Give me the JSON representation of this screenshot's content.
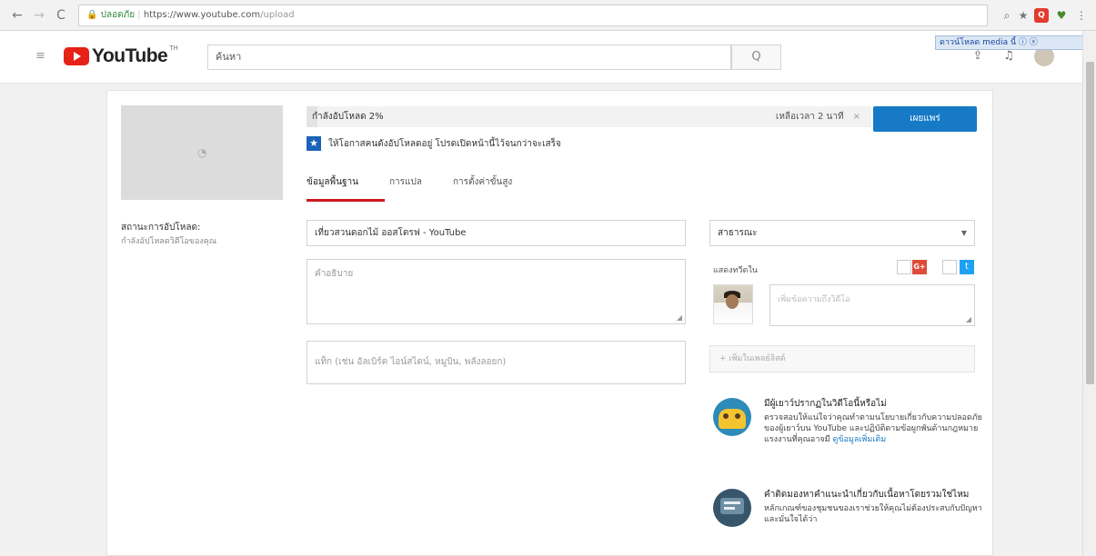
{
  "browser": {
    "back": "←",
    "forward": "→",
    "reload": "C",
    "secure_label": "ปลอดภัย",
    "url_host": "https://www.youtube.com",
    "url_path": "/upload",
    "zoom_icon": "magnifier-icon",
    "star_icon": "★"
  },
  "header": {
    "logo_text": "YouTube",
    "logo_sup": "TH",
    "search_placeholder": "ค้นหา",
    "search_icon": "Q",
    "notice": "ดาวน์โหลด media นี้ ⓘ ⓧ"
  },
  "upload": {
    "status_title": "สถานะการอัปโหลด:",
    "status_sub": "กำลังอัปโหลดวิดีโอของคุณ",
    "progress_label": "กำลังอัปโหลด 2%",
    "progress_percent": 2,
    "remaining": "เหลือเวลา 2 นาที",
    "cancel": "×",
    "publish_label": "เผยแพร่",
    "info_text": "ให้โอกาสคนดังอัปโหลดอยู่ โปรดเปิดหน้านี้ไว้จนกว่าจะเสร็จ"
  },
  "tabs": [
    {
      "label": "ข้อมูลพื้นฐาน",
      "active": true
    },
    {
      "label": "การแปล",
      "active": false
    },
    {
      "label": "การตั้งค่าขั้นสูง",
      "active": false
    }
  ],
  "form": {
    "title_value": "เที่ยวสวนดอกไม้ ออสโตรฟ - YouTube",
    "description_placeholder": "คำอธิบาย",
    "tags_placeholder": "แท็ก (เช่น อัลเบิร์ต ไอน์สไตน์, หมูบิน, พลังลอยก)",
    "privacy_value": "สาธารณะ",
    "share_label": "แสดงทวีตใน",
    "share_placeholder": "เพิ่มข้อความถึงวิดีโอ",
    "playlist_label": "+ เพิ่มในเพลย์ลิสต์"
  },
  "help": [
    {
      "title": "มีผู้เยาว์ปรากฏในวิดีโอนี้หรือไม่",
      "body": "ตรวจสอบให้แน่ใจว่าคุณทำตามนโยบายเกี่ยวกับความปลอดภัยของผู้เยาว์บน YouTube และปฏิบัติตามข้อผูกพันด้านกฎหมายแรงงานที่คุณอาจมี",
      "link": "ดูข้อมูลเพิ่มเติม",
      "icon": "child-safety-icon"
    },
    {
      "title": "คำติดมองหาคำแนะนำเกี่ยวกับเนื้อหาโดยรวมใช่ไหม",
      "body": "หลักเกณฑ์ของชุมชนของเราช่วยให้คุณไม่ต้องประสบกับปัญหาและมั่นใจได้ว่า",
      "link": "",
      "icon": "guidelines-icon"
    }
  ],
  "colors": {
    "accent": "#167ac6",
    "brand_red": "#e62117",
    "tab_underline": "#cc181e"
  }
}
